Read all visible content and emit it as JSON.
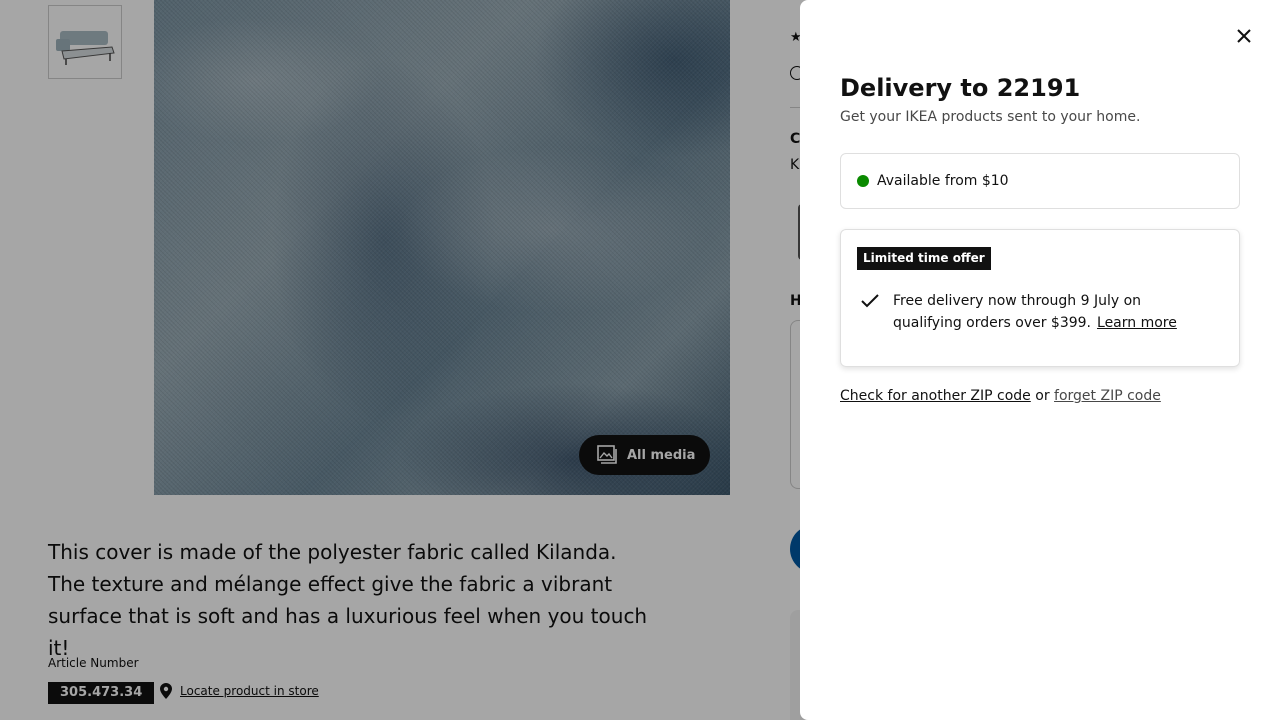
{
  "background": {
    "all_media_label": "All media",
    "description": "This cover is made of the polyester fabric called Kilanda. The texture and mélange effect give the fabric a vibrant surface that is soft and has a luxurious feel when you touch it!",
    "article_label": "Article Number",
    "article_number": "305.473.34",
    "locate_label": "Locate product in store",
    "partial_c": "C",
    "partial_k": "K",
    "partial_h": "H"
  },
  "panel": {
    "title": "Delivery to 22191",
    "subtitle": "Get your IKEA products sent to your home.",
    "availability": "Available from $10",
    "offer_badge": "Limited time offer",
    "offer_text": "Free delivery now through 9 July on qualifying orders over $399.",
    "learn_more": "Learn more",
    "check_zip": "Check for another ZIP code",
    "or": "or",
    "forget_zip": "forget ZIP code"
  },
  "icons": {
    "close": "close-icon",
    "media": "gallery-icon",
    "location": "location-pin-icon",
    "check": "checkmark-icon",
    "star": "star-icon"
  },
  "colors": {
    "available_dot": "#0a8a00",
    "primary_blue": "#0058a3",
    "dark": "#111111"
  }
}
